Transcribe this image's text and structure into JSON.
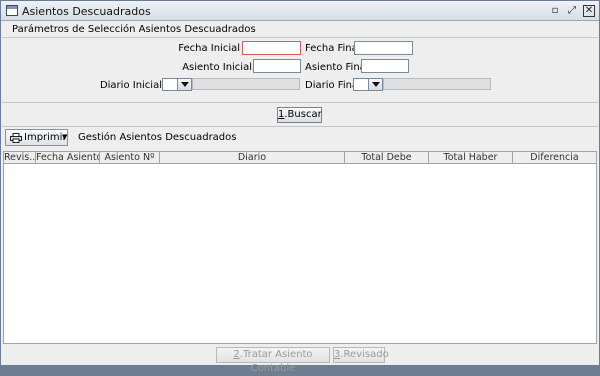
{
  "window": {
    "title": "Asientos Descuadrados",
    "controls": {
      "restore": "▫",
      "maximize": "⤢",
      "close": "✕"
    }
  },
  "params_section": {
    "title": "Parámetros de Selección Asientos Descuadrados",
    "fecha_inicial_label": "Fecha Inicial",
    "fecha_inicial_value": "",
    "fecha_final_label": "Fecha Final",
    "fecha_final_value": "",
    "asiento_inicial_label": "Asiento Inicial",
    "asiento_inicial_value": "",
    "asiento_final_label": "Asiento Final",
    "asiento_final_value": "",
    "diario_inicial_label": "Diario Inicial",
    "diario_final_label": "Diario Final"
  },
  "buscar_button": {
    "mnemonic": "1",
    "label": ".Buscar"
  },
  "toolbar": {
    "print_label": "Imprimir",
    "print_icon": "printer-icon",
    "title": "Gestión Asientos Descuadrados"
  },
  "table": {
    "columns": [
      "Revis...",
      "Fecha Asiento",
      "Asiento Nº",
      "Diario",
      "Total Debe",
      "Total Haber",
      "Diferencia"
    ],
    "rows": []
  },
  "bottom_buttons": {
    "tratar": {
      "mnemonic": "2",
      "label": ".Tratar Asiento Contable"
    },
    "revisado": {
      "mnemonic": "3",
      "label": ".Revisado"
    }
  },
  "colors": {
    "invalid_border": "#e05a5a",
    "disabled_text": "#9a9a9a"
  }
}
